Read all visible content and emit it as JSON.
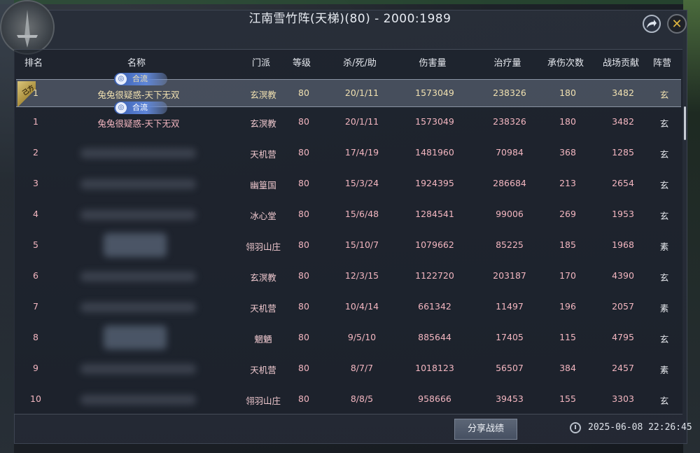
{
  "title": "江南雪竹阵(天梯)(80) - 2000:1989",
  "columns": {
    "rank": "排名",
    "name": "名称",
    "sect": "门派",
    "level": "等级",
    "kda": "杀/死/助",
    "damage": "伤害量",
    "heal": "治疗量",
    "hits": "承伤次数",
    "battlefield": "战场贡献",
    "camp": "阵营"
  },
  "badge_label": "合流",
  "self_row": {
    "rank": "1",
    "name": "兔兔很疑惑-天下无双",
    "sect": "玄溟教",
    "level": "80",
    "kda": "20/1/11",
    "damage": "1573049",
    "heal": "238326",
    "hits": "180",
    "battlefield": "3482",
    "camp": "玄"
  },
  "rows": [
    {
      "rank": "1",
      "name": "兔兔很疑惑-天下无双",
      "sect": "玄溟教",
      "level": "80",
      "kda": "20/1/11",
      "damage": "1573049",
      "heal": "238326",
      "hits": "180",
      "battlefield": "3482",
      "camp": "玄"
    },
    {
      "rank": "2",
      "name": "",
      "sect": "天机营",
      "level": "80",
      "kda": "17/4/19",
      "damage": "1481960",
      "heal": "70984",
      "hits": "368",
      "battlefield": "1285",
      "camp": "玄"
    },
    {
      "rank": "3",
      "name": "",
      "sect": "幽篁国",
      "level": "80",
      "kda": "15/3/24",
      "damage": "1924395",
      "heal": "286684",
      "hits": "213",
      "battlefield": "2654",
      "camp": "玄"
    },
    {
      "rank": "4",
      "name": "",
      "sect": "冰心堂",
      "level": "80",
      "kda": "15/6/48",
      "damage": "1284541",
      "heal": "99006",
      "hits": "269",
      "battlefield": "1953",
      "camp": "玄"
    },
    {
      "rank": "5",
      "name": "",
      "sect": "翎羽山庄",
      "level": "80",
      "kda": "15/10/7",
      "damage": "1079662",
      "heal": "85225",
      "hits": "185",
      "battlefield": "1968",
      "camp": "素"
    },
    {
      "rank": "6",
      "name": "",
      "sect": "玄溟教",
      "level": "80",
      "kda": "12/3/15",
      "damage": "1122720",
      "heal": "203187",
      "hits": "170",
      "battlefield": "4390",
      "camp": "玄"
    },
    {
      "rank": "7",
      "name": "",
      "sect": "天机营",
      "level": "80",
      "kda": "10/4/14",
      "damage": "661342",
      "heal": "11497",
      "hits": "196",
      "battlefield": "2057",
      "camp": "素"
    },
    {
      "rank": "8",
      "name": "",
      "sect": "魍魉",
      "level": "80",
      "kda": "9/5/10",
      "damage": "885644",
      "heal": "17405",
      "hits": "115",
      "battlefield": "4795",
      "camp": "玄"
    },
    {
      "rank": "9",
      "name": "",
      "sect": "天机营",
      "level": "80",
      "kda": "8/7/7",
      "damage": "1018123",
      "heal": "56507",
      "hits": "384",
      "battlefield": "2457",
      "camp": "素"
    },
    {
      "rank": "10",
      "name": "",
      "sect": "翎羽山庄",
      "level": "80",
      "kda": "8/8/5",
      "damage": "958666",
      "heal": "39453",
      "hits": "155",
      "battlefield": "3303",
      "camp": "玄"
    }
  ],
  "share_button": "分享战绩",
  "timestamp": "2025-06-08 22:26:45",
  "flag_label": "己方",
  "icons": {
    "share": "share-arrow-icon",
    "close": "close-icon",
    "clock": "clock-icon",
    "badge": "swirl-icon"
  }
}
